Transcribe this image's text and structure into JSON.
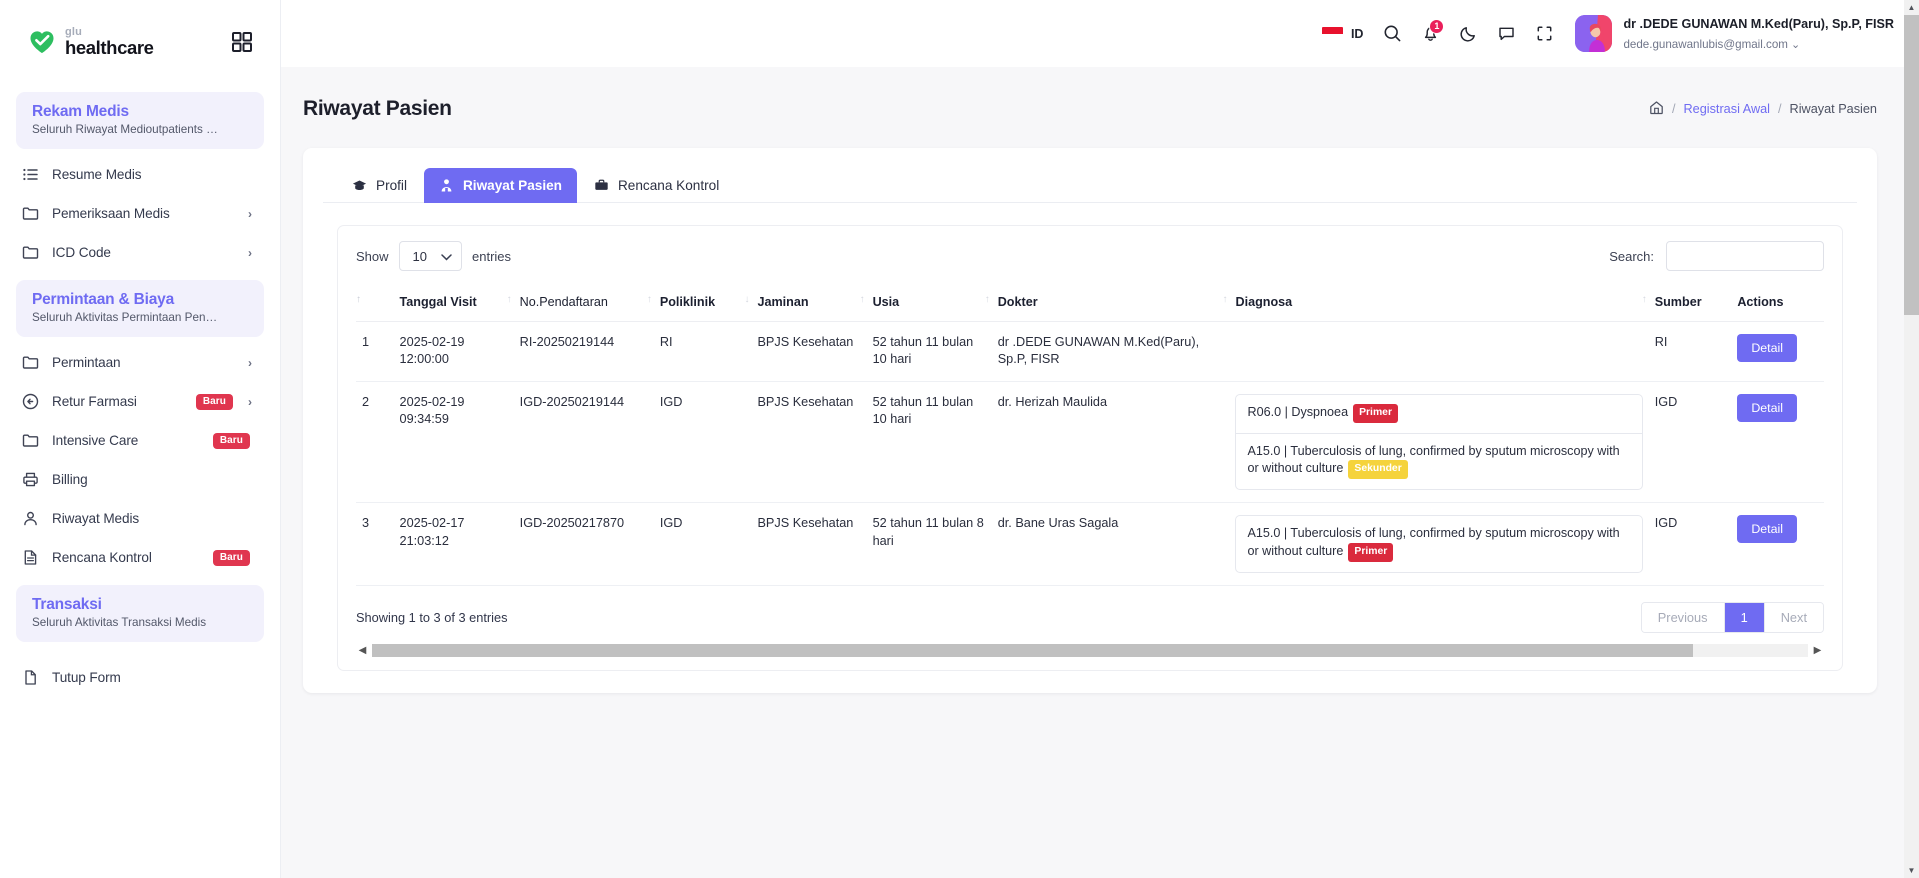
{
  "brand": {
    "top": "glu",
    "bottom": "healthcare",
    "grid_icon": "grid-icon"
  },
  "sidebar": {
    "sections": [
      {
        "title": "Rekam Medis",
        "subtitle": "Seluruh Riwayat Medioutpatients …"
      },
      {
        "title": "Permintaan & Biaya",
        "subtitle": "Seluruh Aktivitas Permintaan Pen…"
      },
      {
        "title": "Transaksi",
        "subtitle": "Seluruh Aktivitas Transaksi Medis"
      }
    ],
    "group1": [
      {
        "label": "Resume Medis",
        "icon": "list-icon",
        "badge": "",
        "chevron": false
      },
      {
        "label": "Pemeriksaan Medis",
        "icon": "folder-icon",
        "badge": "",
        "chevron": true
      },
      {
        "label": "ICD Code",
        "icon": "folder-icon",
        "badge": "",
        "chevron": true
      }
    ],
    "group2": [
      {
        "label": "Permintaan",
        "icon": "folder-icon",
        "badge": "",
        "chevron": true
      },
      {
        "label": "Retur Farmasi",
        "icon": "arrow-left-circle-icon",
        "badge": "Baru",
        "chevron": true
      },
      {
        "label": "Intensive Care",
        "icon": "folder-icon",
        "badge": "Baru",
        "chevron": false
      },
      {
        "label": "Billing",
        "icon": "printer-icon",
        "badge": "",
        "chevron": false
      },
      {
        "label": "Riwayat Medis",
        "icon": "user-icon",
        "badge": "",
        "chevron": false
      },
      {
        "label": "Rencana Kontrol",
        "icon": "file-text-icon",
        "badge": "Baru",
        "chevron": false
      }
    ],
    "group3": [
      {
        "label": "Tutup Form",
        "icon": "file-icon",
        "badge": "",
        "chevron": false
      }
    ]
  },
  "topbar": {
    "language": "ID",
    "flag_icon": "indonesia-flag-icon",
    "search_icon": "search-icon",
    "bell_icon": "bell-icon",
    "notification_count": "1",
    "moon_icon": "moon-icon",
    "chat_icon": "chat-icon",
    "fullscreen_icon": "fullscreen-icon",
    "user_name": "dr .DEDE GUNAWAN M.Ked(Paru), Sp.P, FISR",
    "user_email": "dede.gunawanlubis@gmail.com",
    "user_caret": "chevron-down-icon"
  },
  "page": {
    "title": "Riwayat Pasien",
    "breadcrumb": {
      "home_icon": "home-icon",
      "sep": "/",
      "link": "Registrasi Awal",
      "current": "Riwayat Pasien"
    }
  },
  "tabs": [
    {
      "label": "Profil",
      "icon": "graduation-cap-icon",
      "active": false
    },
    {
      "label": "Riwayat Pasien",
      "icon": "doctor-icon",
      "active": true
    },
    {
      "label": "Rencana Kontrol",
      "icon": "briefcase-icon",
      "active": false
    }
  ],
  "table_controls": {
    "show_label": "Show",
    "show_value": "10",
    "entries_label": "entries",
    "search_label": "Search:",
    "search_value": "",
    "search_placeholder": ""
  },
  "table": {
    "headers": [
      {
        "label": "",
        "key": "no"
      },
      {
        "label": "Tanggal Visit",
        "key": "tanggal"
      },
      {
        "label": "No.Pendaftaran",
        "key": "pendaftaran"
      },
      {
        "label": "Poliklinik",
        "key": "poliklinik"
      },
      {
        "label": "Jaminan",
        "key": "jaminan"
      },
      {
        "label": "Usia",
        "key": "usia"
      },
      {
        "label": "Dokter",
        "key": "dokter"
      },
      {
        "label": "Diagnosa",
        "key": "diagnosa"
      },
      {
        "label": "Sumber",
        "key": "sumber"
      },
      {
        "label": "Actions",
        "key": "actions"
      }
    ],
    "rows": [
      {
        "no": "1",
        "tanggal": "2025-02-19 12:00:00",
        "pendaftaran": "RI-20250219144",
        "poliklinik": "RI",
        "jaminan": "BPJS Kesehatan",
        "usia": "52 tahun 11 bulan 10 hari",
        "dokter": "dr .DEDE GUNAWAN M.Ked(Paru), Sp.P, FISR",
        "diagnosa": [],
        "sumber": "RI",
        "action": "Detail"
      },
      {
        "no": "2",
        "tanggal": "2025-02-19 09:34:59",
        "pendaftaran": "IGD-20250219144",
        "poliklinik": "IGD",
        "jaminan": "BPJS Kesehatan",
        "usia": "52 tahun 11 bulan 10 hari",
        "dokter": "dr. Herizah Maulida",
        "diagnosa": [
          {
            "text": "R06.0 | Dyspnoea",
            "tag": "Primer",
            "tag_type": "primer"
          },
          {
            "text": "A15.0 | Tuberculosis of lung, confirmed by sputum microscopy with or without culture",
            "tag": "Sekunder",
            "tag_type": "sekunder"
          }
        ],
        "sumber": "IGD",
        "action": "Detail"
      },
      {
        "no": "3",
        "tanggal": "2025-02-17 21:03:12",
        "pendaftaran": "IGD-20250217870",
        "poliklinik": "IGD",
        "jaminan": "BPJS Kesehatan",
        "usia": "52 tahun 11 bulan 8 hari",
        "dokter": "dr. Bane Uras Sagala",
        "diagnosa": [
          {
            "text": "A15.0 | Tuberculosis of lung, confirmed by sputum microscopy with or without culture",
            "tag": "Primer",
            "tag_type": "primer"
          }
        ],
        "sumber": "IGD",
        "action": "Detail"
      }
    ]
  },
  "footer": {
    "info": "Showing 1 to 3 of 3 entries",
    "previous": "Previous",
    "page_1": "1",
    "next": "Next"
  },
  "colors": {
    "accent": "#6f6bf2",
    "danger": "#da2a3d",
    "warning": "#f5d33c",
    "badge_new": "#e0364f",
    "brand_green": "#2dbe60"
  }
}
